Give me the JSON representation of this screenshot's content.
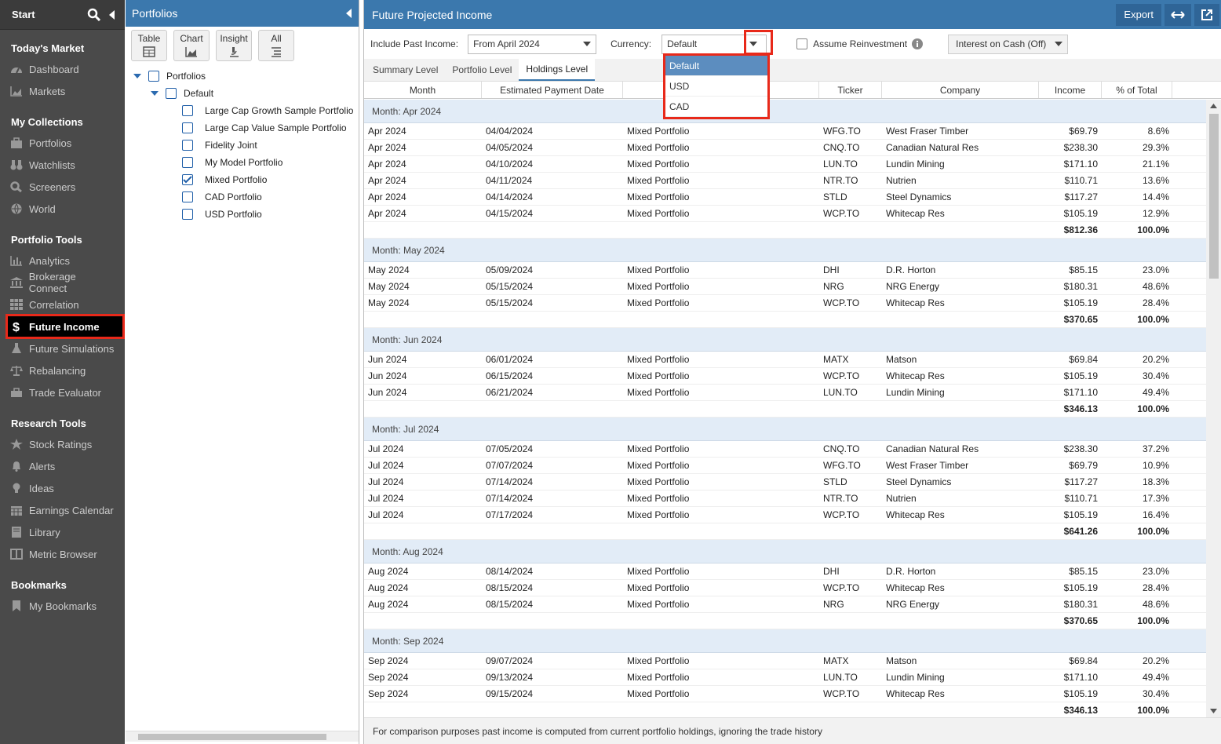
{
  "sidebar": {
    "start": "Start",
    "sections": [
      {
        "title": "Today's Market",
        "items": [
          {
            "label": "Dashboard",
            "icon": "dashboard-icon"
          },
          {
            "label": "Markets",
            "icon": "chart-icon"
          }
        ]
      },
      {
        "title": "My Collections",
        "items": [
          {
            "label": "Portfolios",
            "icon": "briefcase-icon"
          },
          {
            "label": "Watchlists",
            "icon": "binoculars-icon"
          },
          {
            "label": "Screeners",
            "icon": "search-icon"
          },
          {
            "label": "World",
            "icon": "globe-icon"
          }
        ]
      },
      {
        "title": "Portfolio Tools",
        "items": [
          {
            "label": "Analytics",
            "icon": "bar-chart-icon"
          },
          {
            "label": "Brokerage Connect",
            "icon": "bank-icon"
          },
          {
            "label": "Correlation",
            "icon": "grid-icon"
          },
          {
            "label": "Future Income",
            "icon": "dollar-icon",
            "active": true
          },
          {
            "label": "Future Simulations",
            "icon": "flask-icon"
          },
          {
            "label": "Rebalancing",
            "icon": "scale-icon"
          },
          {
            "label": "Trade Evaluator",
            "icon": "toolbox-icon"
          }
        ]
      },
      {
        "title": "Research Tools",
        "items": [
          {
            "label": "Stock Ratings",
            "icon": "star-icon"
          },
          {
            "label": "Alerts",
            "icon": "bell-icon"
          },
          {
            "label": "Ideas",
            "icon": "lightbulb-icon"
          },
          {
            "label": "Earnings Calendar",
            "icon": "calendar-icon"
          },
          {
            "label": "Library",
            "icon": "book-icon"
          },
          {
            "label": "Metric Browser",
            "icon": "columns-icon"
          }
        ]
      },
      {
        "title": "Bookmarks",
        "items": [
          {
            "label": "My Bookmarks",
            "icon": "bookmark-icon"
          }
        ]
      }
    ]
  },
  "portfolios": {
    "title": "Portfolios",
    "toolbar": [
      "Table",
      "Chart",
      "Insight",
      "All"
    ],
    "tree": {
      "root": "Portfolios",
      "group": "Default",
      "items": [
        {
          "label": "Large Cap Growth Sample Portfolio",
          "checked": false
        },
        {
          "label": "Large Cap Value Sample Portfolio",
          "checked": false
        },
        {
          "label": "Fidelity Joint",
          "checked": false
        },
        {
          "label": "My Model Portfolio",
          "checked": false
        },
        {
          "label": "Mixed Portfolio",
          "checked": true
        },
        {
          "label": "CAD Portfolio",
          "checked": false
        },
        {
          "label": "USD Portfolio",
          "checked": false
        }
      ]
    }
  },
  "main": {
    "title": "Future Projected Income",
    "export": "Export",
    "include_past_label": "Include Past Income:",
    "include_past_value": "From April 2024",
    "currency_label": "Currency:",
    "currency_value": "Default",
    "assume_reinvest": "Assume Reinvestment",
    "interest_cash": "Interest on Cash (Off)",
    "currency_options": [
      "Default",
      "USD",
      "CAD"
    ],
    "tabs": [
      "Summary Level",
      "Portfolio Level",
      "Holdings Level"
    ],
    "active_tab": "Holdings Level",
    "columns": [
      "Month",
      "Estimated Payment Date",
      "",
      "Ticker",
      "Company",
      "Income",
      "% of Total"
    ],
    "groups": [
      {
        "header": "Month: Apr 2024",
        "rows": [
          [
            "Apr 2024",
            "04/04/2024",
            "Mixed Portfolio",
            "WFG.TO",
            "West Fraser Timber",
            "$69.79",
            "8.6%"
          ],
          [
            "Apr 2024",
            "04/05/2024",
            "Mixed Portfolio",
            "CNQ.TO",
            "Canadian Natural Res",
            "$238.30",
            "29.3%"
          ],
          [
            "Apr 2024",
            "04/10/2024",
            "Mixed Portfolio",
            "LUN.TO",
            "Lundin Mining",
            "$171.10",
            "21.1%"
          ],
          [
            "Apr 2024",
            "04/11/2024",
            "Mixed Portfolio",
            "NTR.TO",
            "Nutrien",
            "$110.71",
            "13.6%"
          ],
          [
            "Apr 2024",
            "04/14/2024",
            "Mixed Portfolio",
            "STLD",
            "Steel Dynamics",
            "$117.27",
            "14.4%"
          ],
          [
            "Apr 2024",
            "04/15/2024",
            "Mixed Portfolio",
            "WCP.TO",
            "Whitecap Res",
            "$105.19",
            "12.9%"
          ]
        ],
        "total": "$812.36",
        "pct": "100.0%"
      },
      {
        "header": "Month: May 2024",
        "rows": [
          [
            "May 2024",
            "05/09/2024",
            "Mixed Portfolio",
            "DHI",
            "D.R. Horton",
            "$85.15",
            "23.0%"
          ],
          [
            "May 2024",
            "05/15/2024",
            "Mixed Portfolio",
            "NRG",
            "NRG Energy",
            "$180.31",
            "48.6%"
          ],
          [
            "May 2024",
            "05/15/2024",
            "Mixed Portfolio",
            "WCP.TO",
            "Whitecap Res",
            "$105.19",
            "28.4%"
          ]
        ],
        "total": "$370.65",
        "pct": "100.0%"
      },
      {
        "header": "Month: Jun 2024",
        "rows": [
          [
            "Jun 2024",
            "06/01/2024",
            "Mixed Portfolio",
            "MATX",
            "Matson",
            "$69.84",
            "20.2%"
          ],
          [
            "Jun 2024",
            "06/15/2024",
            "Mixed Portfolio",
            "WCP.TO",
            "Whitecap Res",
            "$105.19",
            "30.4%"
          ],
          [
            "Jun 2024",
            "06/21/2024",
            "Mixed Portfolio",
            "LUN.TO",
            "Lundin Mining",
            "$171.10",
            "49.4%"
          ]
        ],
        "total": "$346.13",
        "pct": "100.0%"
      },
      {
        "header": "Month: Jul 2024",
        "rows": [
          [
            "Jul 2024",
            "07/05/2024",
            "Mixed Portfolio",
            "CNQ.TO",
            "Canadian Natural Res",
            "$238.30",
            "37.2%"
          ],
          [
            "Jul 2024",
            "07/07/2024",
            "Mixed Portfolio",
            "WFG.TO",
            "West Fraser Timber",
            "$69.79",
            "10.9%"
          ],
          [
            "Jul 2024",
            "07/14/2024",
            "Mixed Portfolio",
            "STLD",
            "Steel Dynamics",
            "$117.27",
            "18.3%"
          ],
          [
            "Jul 2024",
            "07/14/2024",
            "Mixed Portfolio",
            "NTR.TO",
            "Nutrien",
            "$110.71",
            "17.3%"
          ],
          [
            "Jul 2024",
            "07/17/2024",
            "Mixed Portfolio",
            "WCP.TO",
            "Whitecap Res",
            "$105.19",
            "16.4%"
          ]
        ],
        "total": "$641.26",
        "pct": "100.0%"
      },
      {
        "header": "Month: Aug 2024",
        "rows": [
          [
            "Aug 2024",
            "08/14/2024",
            "Mixed Portfolio",
            "DHI",
            "D.R. Horton",
            "$85.15",
            "23.0%"
          ],
          [
            "Aug 2024",
            "08/15/2024",
            "Mixed Portfolio",
            "WCP.TO",
            "Whitecap Res",
            "$105.19",
            "28.4%"
          ],
          [
            "Aug 2024",
            "08/15/2024",
            "Mixed Portfolio",
            "NRG",
            "NRG Energy",
            "$180.31",
            "48.6%"
          ]
        ],
        "total": "$370.65",
        "pct": "100.0%"
      },
      {
        "header": "Month: Sep 2024",
        "rows": [
          [
            "Sep 2024",
            "09/07/2024",
            "Mixed Portfolio",
            "MATX",
            "Matson",
            "$69.84",
            "20.2%"
          ],
          [
            "Sep 2024",
            "09/13/2024",
            "Mixed Portfolio",
            "LUN.TO",
            "Lundin Mining",
            "$171.10",
            "49.4%"
          ],
          [
            "Sep 2024",
            "09/15/2024",
            "Mixed Portfolio",
            "WCP.TO",
            "Whitecap Res",
            "$105.19",
            "30.4%"
          ]
        ],
        "total": "$346.13",
        "pct": "100.0%"
      }
    ],
    "footer": "For comparison purposes past income is computed from current portfolio holdings, ignoring the trade history"
  }
}
